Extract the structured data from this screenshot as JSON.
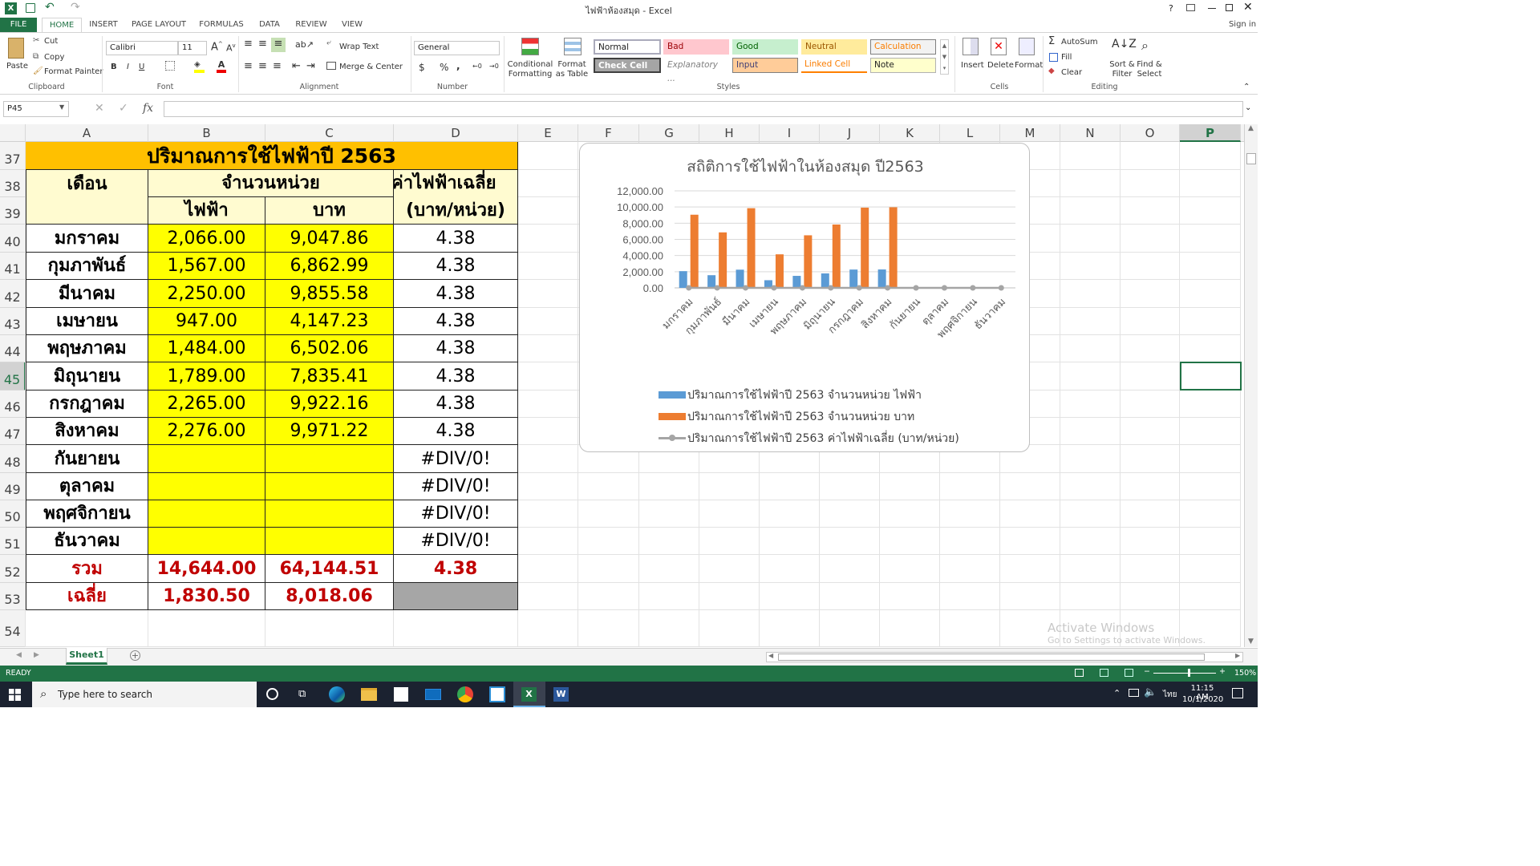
{
  "window": {
    "title": "ไฟฟ้าห้องสมุด - Excel",
    "help": "?",
    "signin": "Sign in"
  },
  "tabs": [
    "FILE",
    "HOME",
    "INSERT",
    "PAGE LAYOUT",
    "FORMULAS",
    "DATA",
    "REVIEW",
    "VIEW"
  ],
  "ribbon": {
    "clipboard": {
      "paste": "Paste",
      "cut": "Cut",
      "copy": "Copy",
      "format_painter": "Format Painter",
      "label": "Clipboard"
    },
    "font": {
      "name": "Calibri",
      "size": "11",
      "bold": "B",
      "italic": "I",
      "underline": "U",
      "label": "Font"
    },
    "alignment": {
      "wrap": "Wrap Text",
      "merge": "Merge & Center",
      "label": "Alignment"
    },
    "number": {
      "format": "General",
      "currency": "$",
      "percent": "%",
      "comma": ",",
      "label": "Number"
    },
    "styles": {
      "conditional": "Conditional Formatting",
      "format_table": "Format as Table",
      "normal": "Normal",
      "bad": "Bad",
      "good": "Good",
      "neutral": "Neutral",
      "calculation": "Calculation",
      "check_cell": "Check Cell",
      "explanatory": "Explanatory ...",
      "input": "Input",
      "linked": "Linked Cell",
      "note": "Note",
      "label": "Styles"
    },
    "cells": {
      "insert": "Insert",
      "delete": "Delete",
      "format": "Format",
      "label": "Cells"
    },
    "editing": {
      "autosum": "AutoSum",
      "fill": "Fill",
      "clear": "Clear",
      "sort": "Sort & Filter",
      "find": "Find & Select",
      "label": "Editing"
    }
  },
  "formula_bar": {
    "name_box": "P45",
    "fx": "fx",
    "formula": ""
  },
  "columns": [
    "A",
    "B",
    "C",
    "D",
    "E",
    "F",
    "G",
    "H",
    "I",
    "J",
    "K",
    "L",
    "M",
    "N",
    "O",
    "P"
  ],
  "rows": [
    "37",
    "38",
    "39",
    "40",
    "41",
    "42",
    "43",
    "44",
    "45",
    "46",
    "47",
    "48",
    "49",
    "50",
    "51",
    "52",
    "53",
    "54"
  ],
  "table": {
    "title": "ปริมาณการใช้ไฟฟ้าปี 2563",
    "hdr_month": "เดือน",
    "hdr_units": "จำนวนหน่วย",
    "hdr_avg": "ค่าไฟฟ้าเฉลี่ย",
    "hdr_elec": "ไฟฟ้า",
    "hdr_baht": "บาท",
    "hdr_avg_unit": "(บาท/หน่วย)",
    "data": [
      {
        "m": "มกราคม",
        "e": "2,066.00",
        "b": "9,047.86",
        "a": "4.38"
      },
      {
        "m": "กุมภาพันธ์",
        "e": "1,567.00",
        "b": "6,862.99",
        "a": "4.38"
      },
      {
        "m": "มีนาคม",
        "e": "2,250.00",
        "b": "9,855.58",
        "a": "4.38"
      },
      {
        "m": "เมษายน",
        "e": "947.00",
        "b": "4,147.23",
        "a": "4.38"
      },
      {
        "m": "พฤษภาคม",
        "e": "1,484.00",
        "b": "6,502.06",
        "a": "4.38"
      },
      {
        "m": "มิถุนายน",
        "e": "1,789.00",
        "b": "7,835.41",
        "a": "4.38"
      },
      {
        "m": "กรกฎาคม",
        "e": "2,265.00",
        "b": "9,922.16",
        "a": "4.38"
      },
      {
        "m": "สิงหาคม",
        "e": "2,276.00",
        "b": "9,971.22",
        "a": "4.38"
      },
      {
        "m": "กันยายน",
        "e": "",
        "b": "",
        "a": "#DIV/0!"
      },
      {
        "m": "ตุลาคม",
        "e": "",
        "b": "",
        "a": "#DIV/0!"
      },
      {
        "m": "พฤศจิกายน",
        "e": "",
        "b": "",
        "a": "#DIV/0!"
      },
      {
        "m": "ธันวาคม",
        "e": "",
        "b": "",
        "a": "#DIV/0!"
      }
    ],
    "total": {
      "m": "รวม",
      "e": "14,644.00",
      "b": "64,144.51",
      "a": "4.38"
    },
    "avg": {
      "m": "เฉลี่ย",
      "e": "1,830.50",
      "b": "8,018.06",
      "a": ""
    }
  },
  "chart_data": {
    "type": "bar",
    "title": "สถิติการใช้ไฟฟ้าในห้องสมุด ปี2563",
    "categories": [
      "มกราคม",
      "กุมภาพันธ์",
      "มีนาคม",
      "เมษายน",
      "พฤษภาคม",
      "มิถุนายน",
      "กรกฎาคม",
      "สิงหาคม",
      "กันยายน",
      "ตุลาคม",
      "พฤศจิกายน",
      "ธันวาคม"
    ],
    "ylim": [
      0,
      12000
    ],
    "yticks": [
      "12,000.00",
      "10,000.00",
      "8,000.00",
      "6,000.00",
      "4,000.00",
      "2,000.00",
      "0.00"
    ],
    "series": [
      {
        "name": "ปริมาณการใช้ไฟฟ้าปี 2563 จำนวนหน่วย ไฟฟ้า",
        "type": "bar",
        "color": "#5b9bd5",
        "values": [
          2066,
          1567,
          2250,
          947,
          1484,
          1789,
          2265,
          2276,
          0,
          0,
          0,
          0
        ]
      },
      {
        "name": "ปริมาณการใช้ไฟฟ้าปี 2563 จำนวนหน่วย บาท",
        "type": "bar",
        "color": "#ed7d31",
        "values": [
          9047.86,
          6862.99,
          9855.58,
          4147.23,
          6502.06,
          7835.41,
          9922.16,
          9971.22,
          0,
          0,
          0,
          0
        ]
      },
      {
        "name": "ปริมาณการใช้ไฟฟ้าปี 2563 ค่าไฟฟ้าเฉลี่ย (บาท/หน่วย)",
        "type": "line",
        "color": "#a5a5a5",
        "values": [
          4.38,
          4.38,
          4.38,
          4.38,
          4.38,
          4.38,
          4.38,
          4.38,
          0,
          0,
          0,
          0
        ]
      }
    ],
    "legend": "bottom",
    "grid": true
  },
  "sheet": {
    "tab": "Sheet1",
    "add": "+"
  },
  "status": {
    "ready": "READY",
    "zoom": "150%"
  },
  "watermark": {
    "line1": "Activate Windows",
    "line2": "Go to Settings to activate Windows."
  },
  "taskbar": {
    "search": "Type here to search",
    "time": "11:15 AM",
    "date": "10/1/2020",
    "lang": "ไทย"
  }
}
